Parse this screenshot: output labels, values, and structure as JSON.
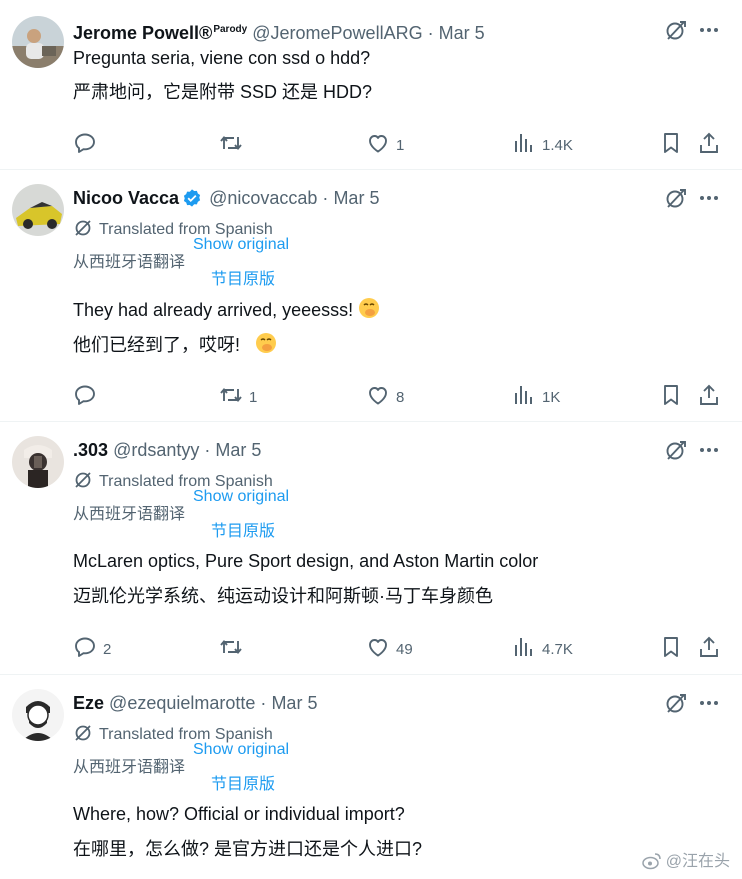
{
  "tweets": [
    {
      "name": "Jerome Powell®",
      "badge": "Parody",
      "handle": "@JeromePowellARG",
      "date": "Mar 5",
      "text_original": "Pregunta seria, viene con ssd o hdd?",
      "text_zh": "严肃地问，它是附带 SSD 还是 HDD?",
      "stats": {
        "replies": "",
        "reposts": "",
        "likes": "1",
        "views": "1.4K"
      }
    },
    {
      "name": "Nicoo Vacca",
      "verified": true,
      "handle": "@nicovaccab",
      "date": "Mar 5",
      "translated_label": "Translated from Spanish",
      "translated_label_zh": "从西班牙语翻译",
      "show_original": "Show original",
      "show_original_zh": "节目原版",
      "text_original": "They had already arrived, yeeesss!",
      "text_zh": "他们已经到了，哎呀!",
      "stats": {
        "replies": "",
        "reposts": "1",
        "likes": "8",
        "views": "1K"
      }
    },
    {
      "name": ".303",
      "handle": "@rdsantyy",
      "date": "Mar 5",
      "translated_label": "Translated from Spanish",
      "translated_label_zh": "从西班牙语翻译",
      "show_original": "Show original",
      "show_original_zh": "节目原版",
      "text_original": "McLaren optics, Pure Sport design, and Aston Martin color",
      "text_zh": "迈凯伦光学系统、纯运动设计和阿斯顿·马丁车身颜色",
      "stats": {
        "replies": "2",
        "reposts": "",
        "likes": "49",
        "views": "4.7K"
      }
    },
    {
      "name": "Eze",
      "handle": "@ezequielmarotte",
      "date": "Mar 5",
      "translated_label": "Translated from Spanish",
      "translated_label_zh": "从西班牙语翻译",
      "show_original": "Show original",
      "show_original_zh": "节目原版",
      "text_original": "Where, how? Official or individual import?",
      "text_zh": "在哪里，怎么做? 是官方进口还是个人进口?"
    }
  ],
  "separator": "·",
  "watermark": "@汪在头",
  "colors": {
    "accent": "#1d9bf0",
    "muted": "#536471",
    "text": "#0f1419",
    "border": "#eff3f4"
  }
}
